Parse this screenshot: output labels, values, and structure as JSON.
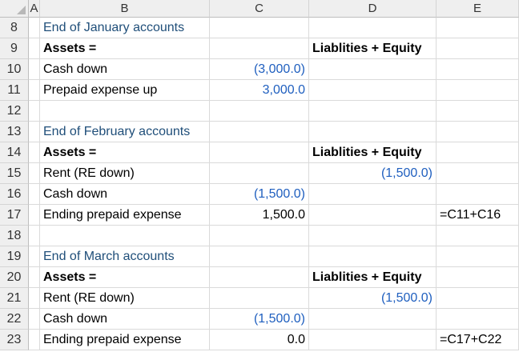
{
  "columns": [
    "A",
    "B",
    "C",
    "D",
    "E"
  ],
  "rows": [
    {
      "num": "8",
      "B": {
        "text": "End of January accounts",
        "style": "heading"
      }
    },
    {
      "num": "9",
      "B": {
        "text": "Assets =",
        "style": "bold"
      },
      "D": {
        "text": "Liablities + Equity",
        "style": "bold"
      }
    },
    {
      "num": "10",
      "B": {
        "text": "Cash down"
      },
      "C": {
        "text": "(3,000.0)",
        "style": "blue"
      }
    },
    {
      "num": "11",
      "B": {
        "text": "Prepaid expense up"
      },
      "C": {
        "text": "3,000.0",
        "style": "blue"
      }
    },
    {
      "num": "12"
    },
    {
      "num": "13",
      "B": {
        "text": "End of February accounts",
        "style": "heading"
      }
    },
    {
      "num": "14",
      "B": {
        "text": "Assets =",
        "style": "bold"
      },
      "D": {
        "text": "Liablities + Equity",
        "style": "bold"
      }
    },
    {
      "num": "15",
      "B": {
        "text": "Rent (RE down)"
      },
      "D": {
        "text": "(1,500.0)",
        "style": "blue",
        "align": "right"
      }
    },
    {
      "num": "16",
      "B": {
        "text": "Cash down"
      },
      "C": {
        "text": "(1,500.0)",
        "style": "blue"
      }
    },
    {
      "num": "17",
      "B": {
        "text": "Ending prepaid expense"
      },
      "C": {
        "text": "1,500.0"
      },
      "E": {
        "text": "=C11+C16"
      }
    },
    {
      "num": "18"
    },
    {
      "num": "19",
      "B": {
        "text": "End of March accounts",
        "style": "heading"
      }
    },
    {
      "num": "20",
      "B": {
        "text": "Assets =",
        "style": "bold"
      },
      "D": {
        "text": "Liablities + Equity",
        "style": "bold"
      }
    },
    {
      "num": "21",
      "B": {
        "text": "Rent (RE down)"
      },
      "D": {
        "text": "(1,500.0)",
        "style": "blue",
        "align": "right"
      }
    },
    {
      "num": "22",
      "B": {
        "text": "Cash down"
      },
      "C": {
        "text": "(1,500.0)",
        "style": "blue"
      }
    },
    {
      "num": "23",
      "B": {
        "text": "Ending prepaid expense"
      },
      "C": {
        "text": "0.0"
      },
      "E": {
        "text": "=C17+C22"
      }
    }
  ]
}
